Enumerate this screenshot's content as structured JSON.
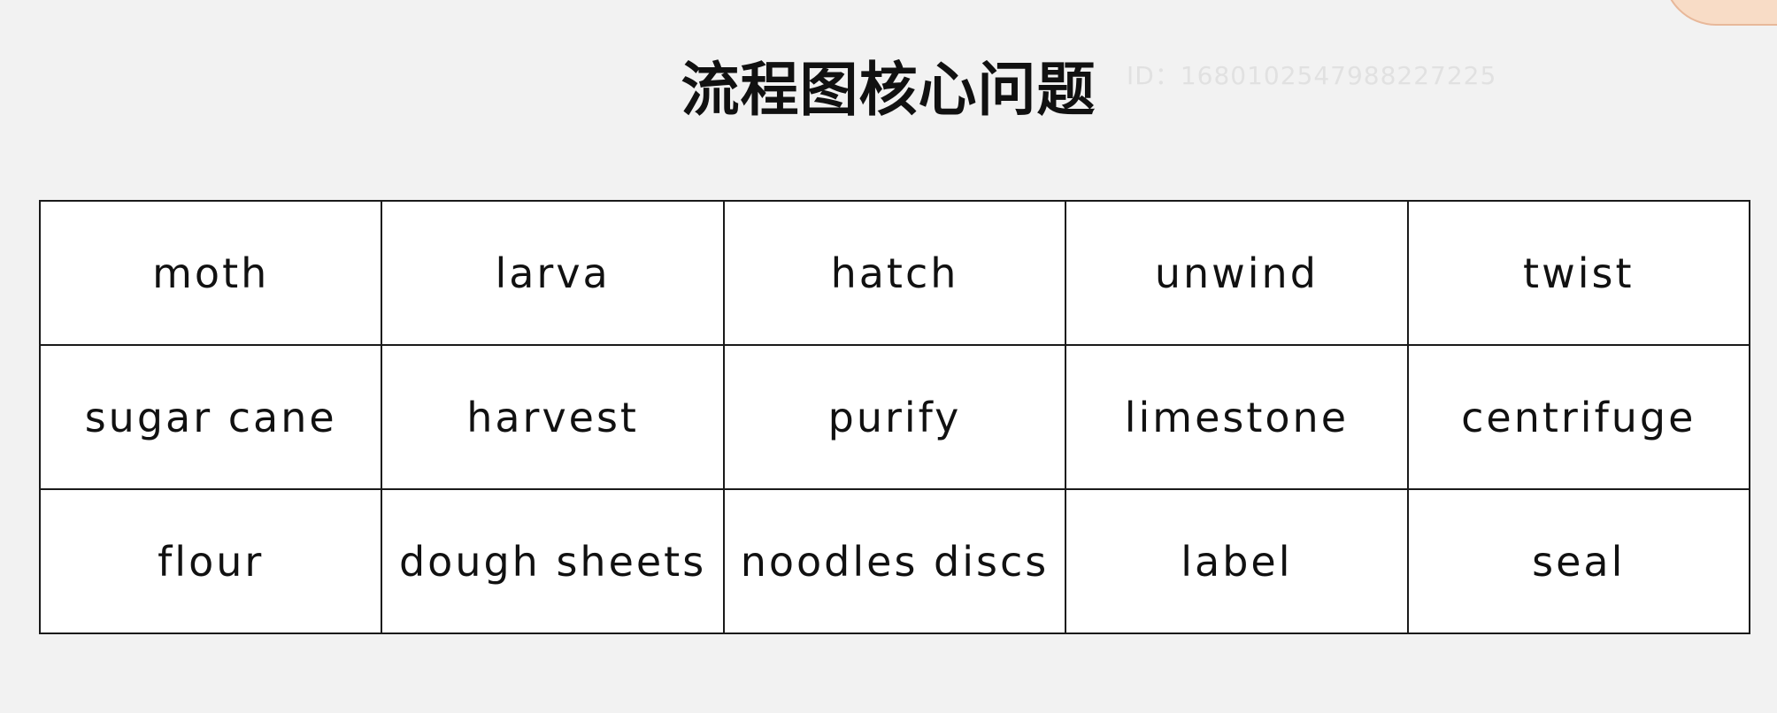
{
  "title": "流程图核心问题",
  "watermark": "ID：1680102547988227225",
  "table": {
    "rows": [
      [
        "moth",
        "larva",
        "hatch",
        "unwind",
        "twist"
      ],
      [
        "sugar cane",
        "harvest",
        "purify",
        "limestone",
        "centrifuge"
      ],
      [
        "flour",
        "dough sheets",
        "noodles discs",
        "label",
        "seal"
      ]
    ]
  }
}
